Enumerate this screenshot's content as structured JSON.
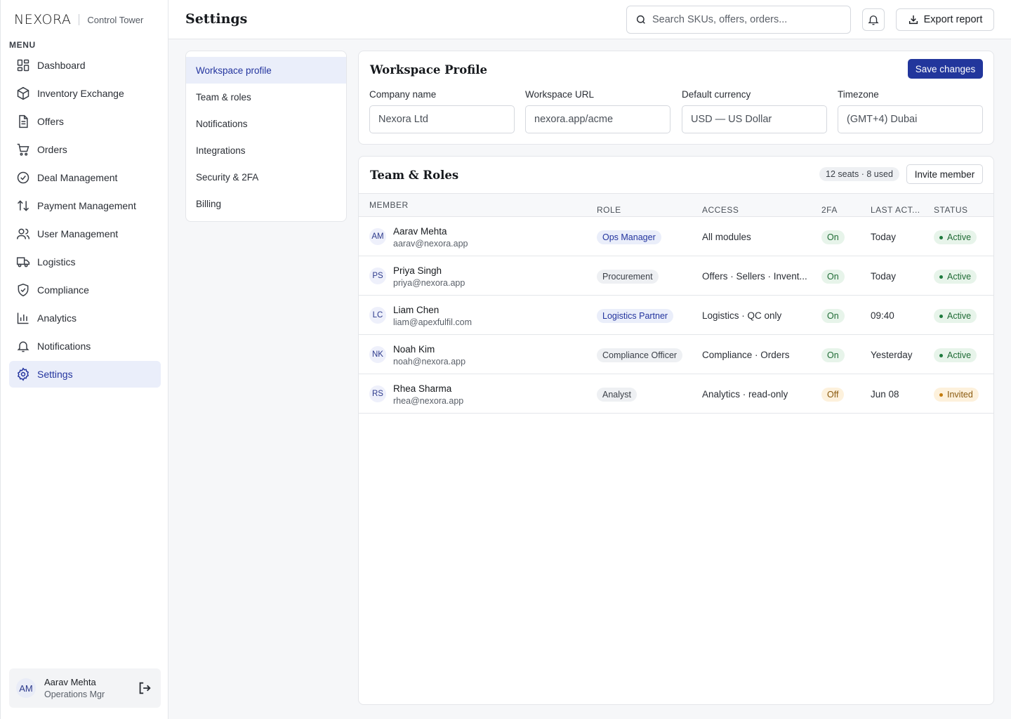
{
  "brand": {
    "logo": "NEXORA",
    "subtitle": "Control Tower"
  },
  "sidebar": {
    "menu_label": "MENU",
    "items": [
      {
        "label": "Dashboard",
        "icon": "dashboard-icon"
      },
      {
        "label": "Inventory Exchange",
        "icon": "box-icon"
      },
      {
        "label": "Offers",
        "icon": "document-icon"
      },
      {
        "label": "Orders",
        "icon": "cart-icon"
      },
      {
        "label": "Deal Management",
        "icon": "check-circle-icon"
      },
      {
        "label": "Payment Management",
        "icon": "arrows-up-down-icon"
      },
      {
        "label": "User Management",
        "icon": "users-icon"
      },
      {
        "label": "Logistics",
        "icon": "truck-icon"
      },
      {
        "label": "Compliance",
        "icon": "shield-check-icon"
      },
      {
        "label": "Analytics",
        "icon": "bar-chart-icon"
      },
      {
        "label": "Notifications",
        "icon": "bell-icon"
      },
      {
        "label": "Settings",
        "icon": "gear-icon",
        "active": true
      }
    ],
    "user": {
      "initials": "AM",
      "name": "Aarav Mehta",
      "role": "Operations Mgr"
    }
  },
  "header": {
    "title": "Settings",
    "search_placeholder": "Search SKUs, offers, orders...",
    "export_label": "Export report"
  },
  "subnav": {
    "items": [
      "Workspace profile",
      "Team & roles",
      "Notifications",
      "Integrations",
      "Security & 2FA",
      "Billing"
    ],
    "active": "Workspace profile"
  },
  "profile": {
    "title": "Workspace Profile",
    "save_label": "Save changes",
    "fields": [
      {
        "label": "Company name",
        "value": "Nexora Ltd"
      },
      {
        "label": "Workspace URL",
        "value": "nexora.app/acme"
      },
      {
        "label": "Default currency",
        "value": "USD — US Dollar"
      },
      {
        "label": "Timezone",
        "value": "(GMT+4) Dubai"
      }
    ]
  },
  "team": {
    "title": "Team & Roles",
    "seats": "12 seats · 8 used",
    "invite_label": "Invite member",
    "columns": [
      "MEMBER",
      "ROLE",
      "ACCESS",
      "2FA",
      "LAST ACT...",
      "STATUS"
    ],
    "rows": [
      {
        "initials": "AM",
        "name": "Aarav Mehta",
        "email": "aarav@nexora.app",
        "role": "Ops Manager",
        "role_color": "blue",
        "access": "All modules",
        "twofa": "On",
        "last": "Today",
        "status": "Active"
      },
      {
        "initials": "PS",
        "name": "Priya Singh",
        "email": "priya@nexora.app",
        "role": "Procurement",
        "role_color": "gray",
        "access": "Offers · Sellers · Invent...",
        "twofa": "On",
        "last": "Today",
        "status": "Active"
      },
      {
        "initials": "LC",
        "name": "Liam Chen",
        "email": "liam@apexfulfil.com",
        "role": "Logistics Partner",
        "role_color": "blue",
        "access": "Logistics · QC only",
        "twofa": "On",
        "last": "09:40",
        "status": "Active"
      },
      {
        "initials": "NK",
        "name": "Noah Kim",
        "email": "noah@nexora.app",
        "role": "Compliance Officer",
        "role_color": "gray",
        "access": "Compliance · Orders",
        "twofa": "On",
        "last": "Yesterday",
        "status": "Active"
      },
      {
        "initials": "RS",
        "name": "Rhea Sharma",
        "email": "rhea@nexora.app",
        "role": "Analyst",
        "role_color": "gray",
        "access": "Analytics · read-only",
        "twofa": "Off",
        "last": "Jun 08",
        "status": "Invited"
      }
    ]
  },
  "colors": {
    "accent": "#22369c",
    "active_bg": "#eaeefa",
    "success": "#1f6b35",
    "warning": "#8a5a0f"
  }
}
